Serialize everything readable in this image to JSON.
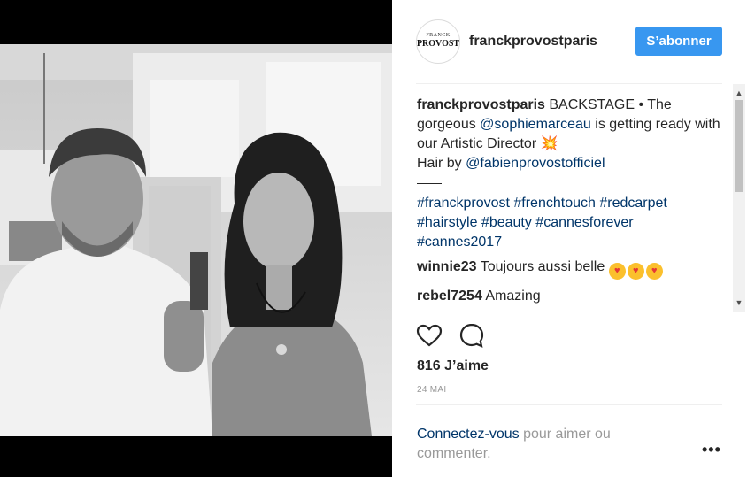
{
  "header": {
    "avatar_top": "FRANCK",
    "avatar_brand": "PROVOST",
    "username": "franckprovostparis",
    "follow_label": "S’abonner"
  },
  "caption": {
    "username": "franckprovostparis",
    "text_1": " BACKSTAGE • The gorgeous ",
    "mention_1": "@sophiemarceau",
    "text_2": " is getting ready with our Artistic Director ",
    "emoji": "💥",
    "text_3": "Hair by ",
    "mention_2": "@fabienprovostofficiel",
    "hashtags_line_1": "#franckprovost #frenchtouch #redcarpet",
    "hashtags_line_2": "#hairstyle #beauty #cannesforever",
    "hashtags_line_3": "#cannes2017"
  },
  "comments": [
    {
      "username": "winnie23",
      "text": " Toujours aussi belle "
    },
    {
      "username": "rebel7254",
      "text": " Amazing"
    }
  ],
  "icons": [
    "heart-icon",
    "comment-icon",
    "more-options-icon",
    "scroll-up-icon",
    "scroll-down-icon"
  ],
  "stats": {
    "likes": "816 J’aime",
    "date": "24 MAI"
  },
  "login_prompt": {
    "link": "Connectez-vous",
    "text": " pour aimer ou commenter."
  },
  "colors": {
    "accent": "#3897f0",
    "link": "#003569",
    "muted": "#999999",
    "text": "#262626"
  }
}
